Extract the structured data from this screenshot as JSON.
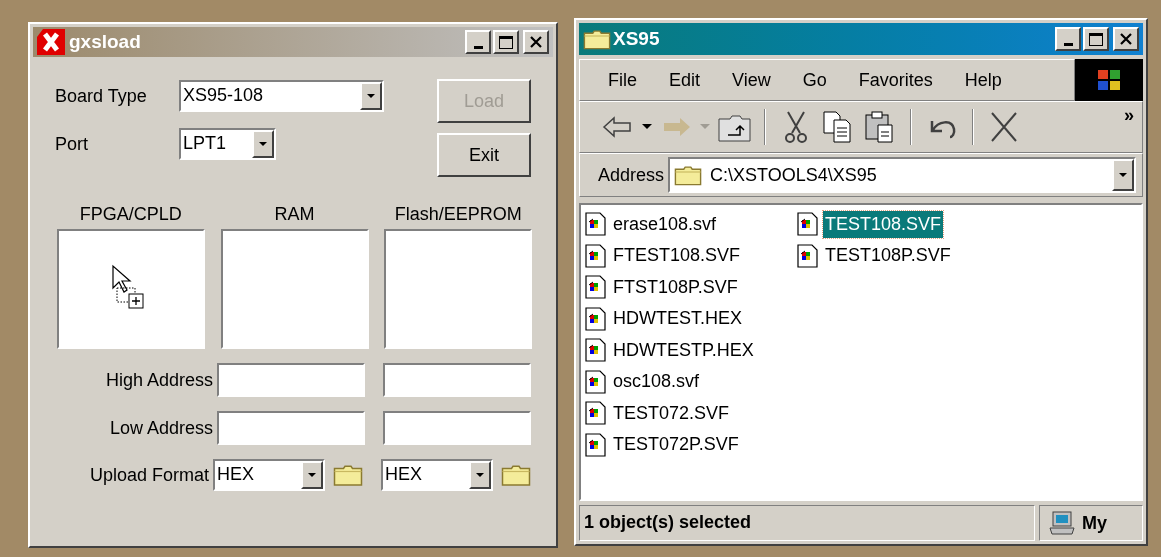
{
  "gxsload": {
    "title": "gxsload",
    "active": false,
    "board_type": {
      "label": "Board Type",
      "value": "XS95-108"
    },
    "port": {
      "label": "Port",
      "value": "LPT1"
    },
    "buttons": [
      {
        "label": "Load",
        "disabled": true
      },
      {
        "label": "Exit",
        "disabled": false
      }
    ],
    "targets": [
      {
        "label": "FPGA/CPLD",
        "drop_cursor": true
      },
      {
        "label": "RAM",
        "drop_cursor": false
      },
      {
        "label": "Flash/EEPROM",
        "drop_cursor": false
      }
    ],
    "high_address": {
      "label": "High Address"
    },
    "low_address": {
      "label": "Low Address"
    },
    "upload_format": {
      "label": "Upload Format",
      "values": [
        "HEX",
        "HEX"
      ]
    }
  },
  "explorer": {
    "title": "XS95",
    "active": true,
    "menu": [
      "File",
      "Edit",
      "View",
      "Go",
      "Favorites",
      "Help"
    ],
    "toolbar_more": "»",
    "address": {
      "label": "Address",
      "value": "C:\\XSTOOLS4\\XS95"
    },
    "files": [
      {
        "name": "erase108.svf",
        "selected": false
      },
      {
        "name": "FTEST108.SVF",
        "selected": false
      },
      {
        "name": "FTST108P.SVF",
        "selected": false
      },
      {
        "name": "HDWTEST.HEX",
        "selected": false
      },
      {
        "name": "HDWTESTP.HEX",
        "selected": false
      },
      {
        "name": "osc108.svf",
        "selected": false
      },
      {
        "name": "TEST072.SVF",
        "selected": false
      },
      {
        "name": "TEST072P.SVF",
        "selected": false
      },
      {
        "name": "TEST108.SVF",
        "selected": true
      },
      {
        "name": "TEST108P.SVF",
        "selected": false
      }
    ],
    "status": "1 object(s) selected",
    "zone": "My"
  }
}
